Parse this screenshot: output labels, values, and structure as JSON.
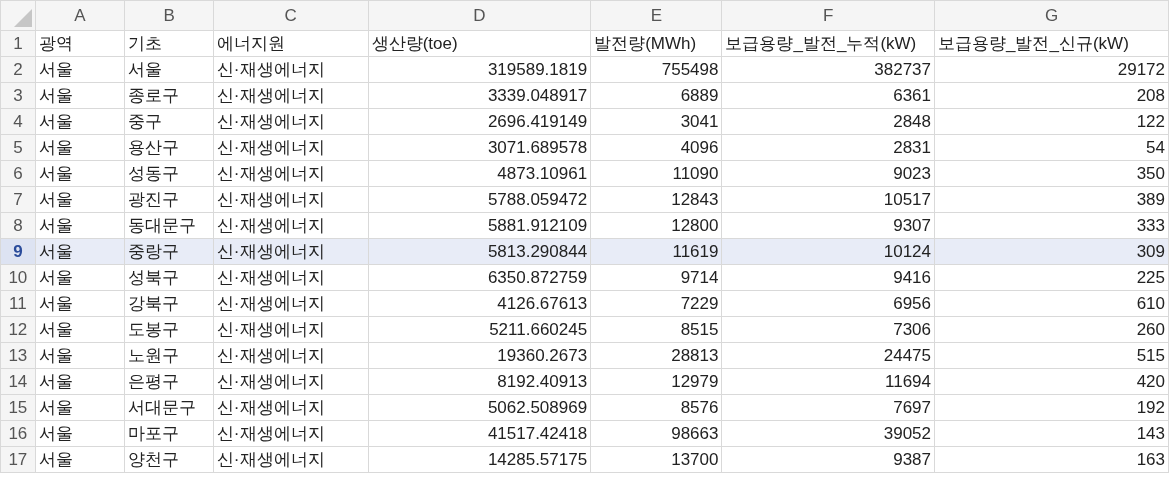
{
  "columns": [
    "A",
    "B",
    "C",
    "D",
    "E",
    "F",
    "G"
  ],
  "rows": [
    {
      "number": "1",
      "kind": "header",
      "selected": false,
      "cells": [
        "광역",
        "기초",
        "에너지원",
        "생산량(toe)",
        "발전량(MWh)",
        "보급용량_발전_누적(kW)",
        "보급용량_발전_신규(kW)"
      ]
    },
    {
      "number": "2",
      "kind": "data",
      "selected": false,
      "cells": [
        "서울",
        "서울",
        "신·재생에너지",
        "319589.1819",
        "755498",
        "382737",
        "29172"
      ]
    },
    {
      "number": "3",
      "kind": "data",
      "selected": false,
      "cells": [
        "서울",
        "종로구",
        "신·재생에너지",
        "3339.048917",
        "6889",
        "6361",
        "208"
      ]
    },
    {
      "number": "4",
      "kind": "data",
      "selected": false,
      "cells": [
        "서울",
        "중구",
        "신·재생에너지",
        "2696.419149",
        "3041",
        "2848",
        "122"
      ]
    },
    {
      "number": "5",
      "kind": "data",
      "selected": false,
      "cells": [
        "서울",
        "용산구",
        "신·재생에너지",
        "3071.689578",
        "4096",
        "2831",
        "54"
      ]
    },
    {
      "number": "6",
      "kind": "data",
      "selected": false,
      "cells": [
        "서울",
        "성동구",
        "신·재생에너지",
        "4873.10961",
        "11090",
        "9023",
        "350"
      ]
    },
    {
      "number": "7",
      "kind": "data",
      "selected": false,
      "cells": [
        "서울",
        "광진구",
        "신·재생에너지",
        "5788.059472",
        "12843",
        "10517",
        "389"
      ]
    },
    {
      "number": "8",
      "kind": "data",
      "selected": false,
      "cells": [
        "서울",
        "동대문구",
        "신·재생에너지",
        "5881.912109",
        "12800",
        "9307",
        "333"
      ]
    },
    {
      "number": "9",
      "kind": "data",
      "selected": true,
      "cells": [
        "서울",
        "중랑구",
        "신·재생에너지",
        "5813.290844",
        "11619",
        "10124",
        "309"
      ]
    },
    {
      "number": "10",
      "kind": "data",
      "selected": false,
      "cells": [
        "서울",
        "성북구",
        "신·재생에너지",
        "6350.872759",
        "9714",
        "9416",
        "225"
      ]
    },
    {
      "number": "11",
      "kind": "data",
      "selected": false,
      "cells": [
        "서울",
        "강북구",
        "신·재생에너지",
        "4126.67613",
        "7229",
        "6956",
        "610"
      ]
    },
    {
      "number": "12",
      "kind": "data",
      "selected": false,
      "cells": [
        "서울",
        "도봉구",
        "신·재생에너지",
        "5211.660245",
        "8515",
        "7306",
        "260"
      ]
    },
    {
      "number": "13",
      "kind": "data",
      "selected": false,
      "cells": [
        "서울",
        "노원구",
        "신·재생에너지",
        "19360.2673",
        "28813",
        "24475",
        "515"
      ]
    },
    {
      "number": "14",
      "kind": "data",
      "selected": false,
      "cells": [
        "서울",
        "은평구",
        "신·재생에너지",
        "8192.40913",
        "12979",
        "11694",
        "420"
      ]
    },
    {
      "number": "15",
      "kind": "data",
      "selected": false,
      "cells": [
        "서울",
        "서대문구",
        "신·재생에너지",
        "5062.508969",
        "8576",
        "7697",
        "192"
      ]
    },
    {
      "number": "16",
      "kind": "data",
      "selected": false,
      "cells": [
        "서울",
        "마포구",
        "신·재생에너지",
        "41517.42418",
        "98663",
        "39052",
        "143"
      ]
    },
    {
      "number": "17",
      "kind": "data",
      "selected": false,
      "cells": [
        "서울",
        "양천구",
        "신·재생에너지",
        "14285.57175",
        "13700",
        "9387",
        "163"
      ]
    }
  ]
}
